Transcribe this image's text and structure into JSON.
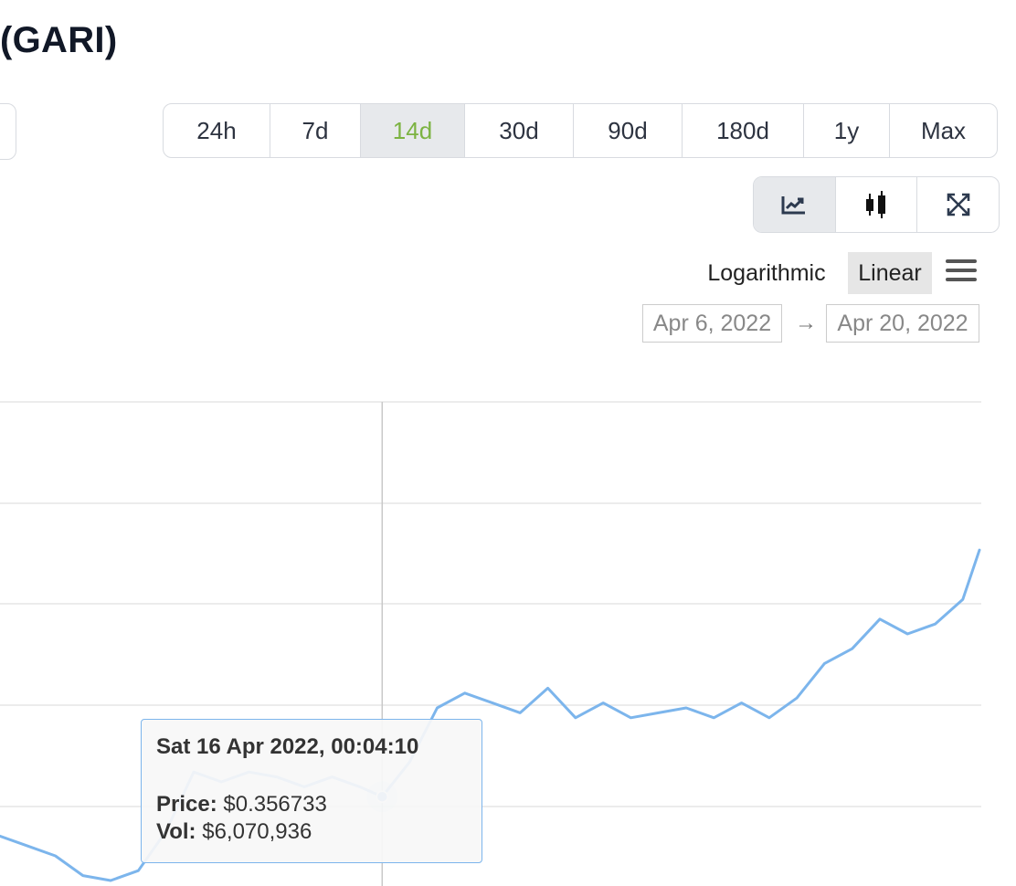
{
  "header": {
    "title": "(GARI)"
  },
  "ranges": [
    {
      "label": "24h",
      "active": false
    },
    {
      "label": "7d",
      "active": false
    },
    {
      "label": "14d",
      "active": true
    },
    {
      "label": "30d",
      "active": false
    },
    {
      "label": "90d",
      "active": false
    },
    {
      "label": "180d",
      "active": false
    },
    {
      "label": "1y",
      "active": false
    },
    {
      "label": "Max",
      "active": false
    }
  ],
  "view_buttons": [
    {
      "icon": "line-chart-icon",
      "active": true
    },
    {
      "icon": "candlestick-icon",
      "active": false
    },
    {
      "icon": "expand-icon",
      "active": false
    }
  ],
  "scale": {
    "log_label": "Logarithmic",
    "linear_label": "Linear",
    "active": "Linear"
  },
  "date_range": {
    "from": "Apr 6, 2022",
    "to": "Apr 20, 2022",
    "arrow": "→"
  },
  "tooltip": {
    "date": "Sat 16 Apr 2022, 00:04:10",
    "price_label": "Price:",
    "price_value": "$0.356733",
    "vol_label": "Vol:",
    "vol_value": "$6,070,936"
  },
  "colors": {
    "line": "#7cb5ec",
    "active_range": "#7cb342",
    "grid": "#e6e6e6"
  },
  "chart_data": {
    "type": "line",
    "x": [
      "2022-04-13T03:00",
      "2022-04-13T08:00",
      "2022-04-13T13:00",
      "2022-04-13T18:00",
      "2022-04-13T23:00",
      "2022-04-14T04:00",
      "2022-04-14T09:00",
      "2022-04-14T14:00",
      "2022-04-14T19:00",
      "2022-04-15T00:00",
      "2022-04-15T05:00",
      "2022-04-15T10:00",
      "2022-04-15T15:00",
      "2022-04-15T20:00",
      "2022-04-16T00:04",
      "2022-04-16T05:00",
      "2022-04-16T10:00",
      "2022-04-16T15:00",
      "2022-04-16T20:00",
      "2022-04-17T01:00",
      "2022-04-17T06:00",
      "2022-04-17T11:00",
      "2022-04-17T16:00",
      "2022-04-17T21:00",
      "2022-04-18T02:00",
      "2022-04-18T07:00",
      "2022-04-18T12:00",
      "2022-04-18T17:00",
      "2022-04-18T22:00",
      "2022-04-19T03:00",
      "2022-04-19T08:00",
      "2022-04-19T13:00",
      "2022-04-19T18:00",
      "2022-04-19T23:00",
      "2022-04-20T04:00",
      "2022-04-20T09:00",
      "2022-04-20T12:00"
    ],
    "y": [
      0.349,
      0.347,
      0.345,
      0.341,
      0.34,
      0.342,
      0.35,
      0.362,
      0.36,
      0.362,
      0.361,
      0.359,
      0.361,
      0.359,
      0.357,
      0.364,
      0.375,
      0.378,
      0.376,
      0.374,
      0.379,
      0.373,
      0.376,
      0.373,
      0.374,
      0.375,
      0.373,
      0.376,
      0.373,
      0.377,
      0.384,
      0.387,
      0.393,
      0.39,
      0.392,
      0.397,
      0.407
    ],
    "series": [
      {
        "name": "Price"
      }
    ],
    "grid": true,
    "scale": "linear"
  }
}
